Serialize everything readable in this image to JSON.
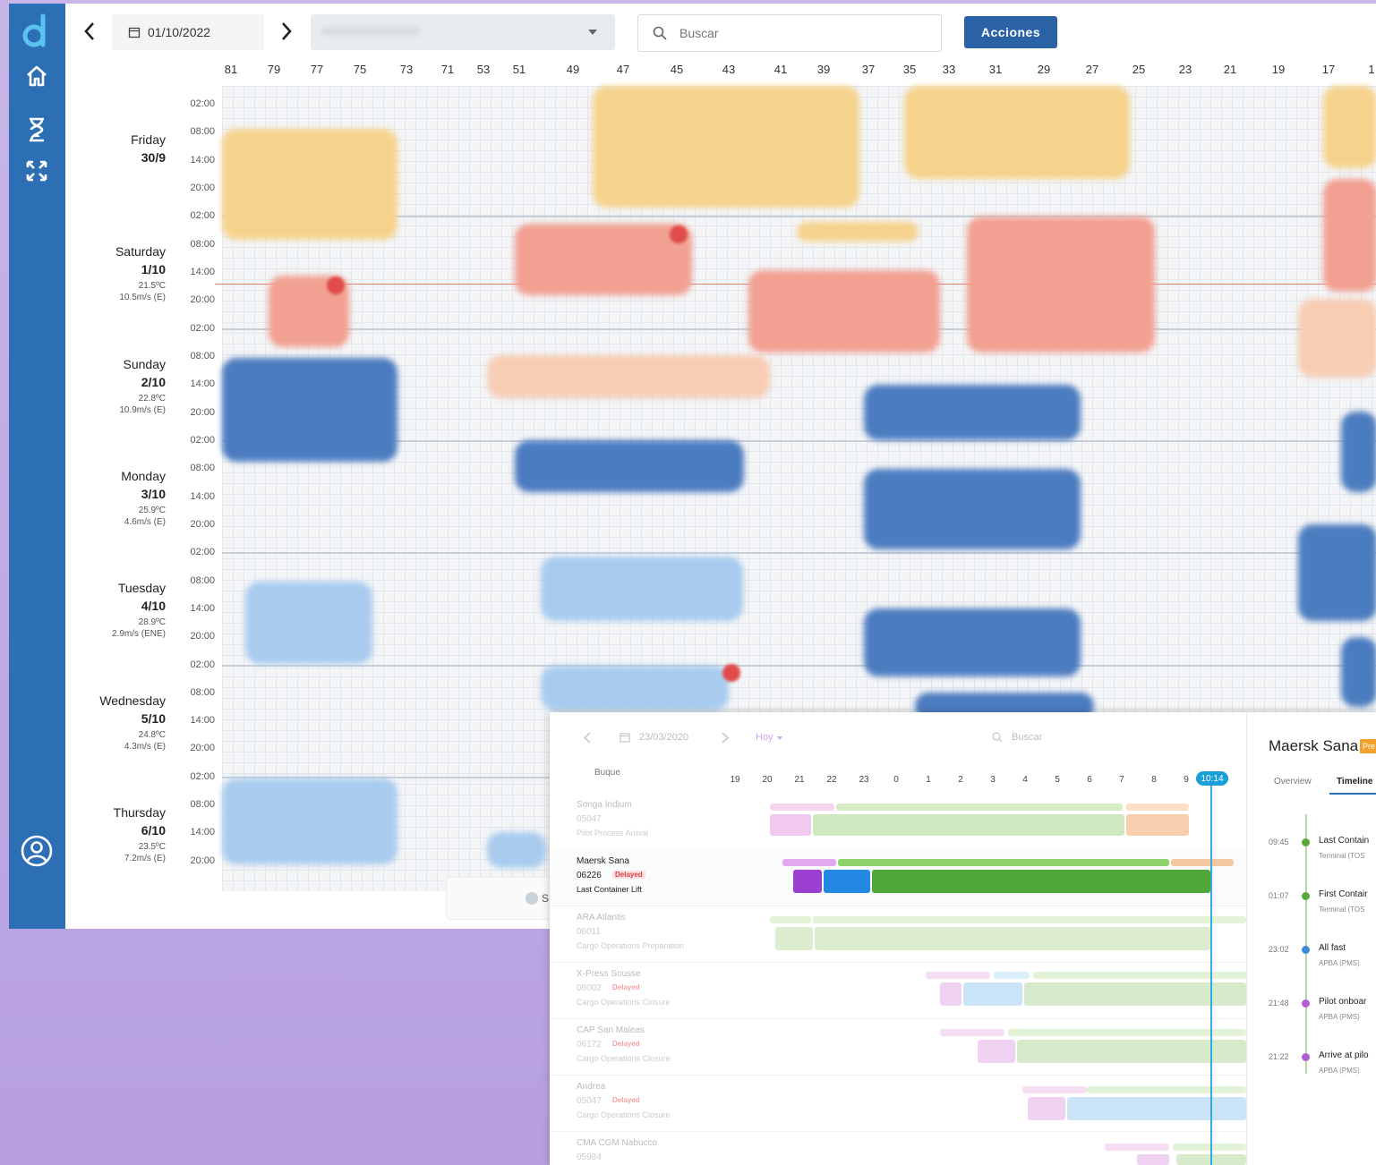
{
  "sidebar": {
    "logo": "logo-icon",
    "items": [
      {
        "icon": "home-icon"
      },
      {
        "icon": "hourglass-icon"
      },
      {
        "icon": "expand-icon"
      }
    ],
    "account_icon": "user-circle-icon"
  },
  "topbar": {
    "date": "01/10/2022",
    "search_placeholder": "Buscar",
    "actions_label": "Acciones"
  },
  "columns": [
    "81",
    "79",
    "77",
    "75",
    "73",
    "71",
    "53",
    "51",
    "49",
    "47",
    "45",
    "43",
    "41",
    "39",
    "37",
    "35",
    "33",
    "31",
    "29",
    "27",
    "25",
    "23",
    "21",
    "19",
    "17",
    "1"
  ],
  "days": [
    {
      "name": "Friday",
      "date": "30/9",
      "weather": [
        "",
        ""
      ]
    },
    {
      "name": "Saturday",
      "date": "1/10",
      "weather": [
        "21.5ºC",
        "10.5m/s (E)"
      ]
    },
    {
      "name": "Sunday",
      "date": "2/10",
      "weather": [
        "22.8ºC",
        "10.9m/s (E)"
      ]
    },
    {
      "name": "Monday",
      "date": "3/10",
      "weather": [
        "25.9ºC",
        "4.6m/s (E)"
      ]
    },
    {
      "name": "Tuesday",
      "date": "4/10",
      "weather": [
        "28.9ºC",
        "2.9m/s (ENE)"
      ]
    },
    {
      "name": "Wednesday",
      "date": "5/10",
      "weather": [
        "24.8ºC",
        "4.3m/s (E)"
      ]
    },
    {
      "name": "Thursday",
      "date": "6/10",
      "weather": [
        "23.5ºC",
        "7.2m/s (E)"
      ]
    }
  ],
  "time_labels": [
    "02:00",
    "08:00",
    "14:00",
    "20:00"
  ],
  "overlay": {
    "date": "23/03/2020",
    "today": "Hoy",
    "search_placeholder": "Buscar",
    "vessel_header": "Buque",
    "hours": [
      "19",
      "20",
      "21",
      "22",
      "23",
      "0",
      "1",
      "2",
      "3",
      "4",
      "5",
      "6",
      "7",
      "8",
      "9"
    ],
    "now": "10:14",
    "rows": [
      {
        "name": "Songa Iridium",
        "code": "05047",
        "tag": "",
        "status": "Pilot Process Arrival"
      },
      {
        "name": "Maersk Sana",
        "code": "06226",
        "tag": "Delayed",
        "status": "Last Container Lift"
      },
      {
        "name": "ARA Atlantis",
        "code": "06011",
        "tag": "",
        "status": "Cargo Operations Preparation"
      },
      {
        "name": "X-Press Sousse",
        "code": "06002",
        "tag": "Delayed",
        "status": "Cargo Operations Closure"
      },
      {
        "name": "CAP San Maleas",
        "code": "06172",
        "tag": "Delayed",
        "status": "Cargo Operations Closure"
      },
      {
        "name": "Andrea",
        "code": "05047",
        "tag": "Delayed",
        "status": "Cargo Operations Closure"
      },
      {
        "name": "CMA CGM Nabucco",
        "code": "05984",
        "tag": "",
        "status": ""
      }
    ],
    "detail": {
      "title": "Maersk Sana",
      "badge": "Pre",
      "tabs": [
        "Overview",
        "Timeline"
      ],
      "events": [
        {
          "time": "09:45",
          "event": "Last Contain",
          "source": "Terminal (TOS",
          "color": "#5aa83a"
        },
        {
          "time": "01:07",
          "event": "First Contair",
          "source": "Terminal (TOS",
          "color": "#5aa83a"
        },
        {
          "time": "23:02",
          "event": "All fast",
          "source": "APBA (PMS)",
          "color": "#3b8be0"
        },
        {
          "time": "21:48",
          "event": "Pilot onboar",
          "source": "APBA (PMS)",
          "color": "#b25bd6"
        },
        {
          "time": "21:22",
          "event": "Arrive at pilo",
          "source": "APBA (PMS)",
          "color": "#b25bd6"
        }
      ]
    },
    "bottom_hint": "S"
  }
}
